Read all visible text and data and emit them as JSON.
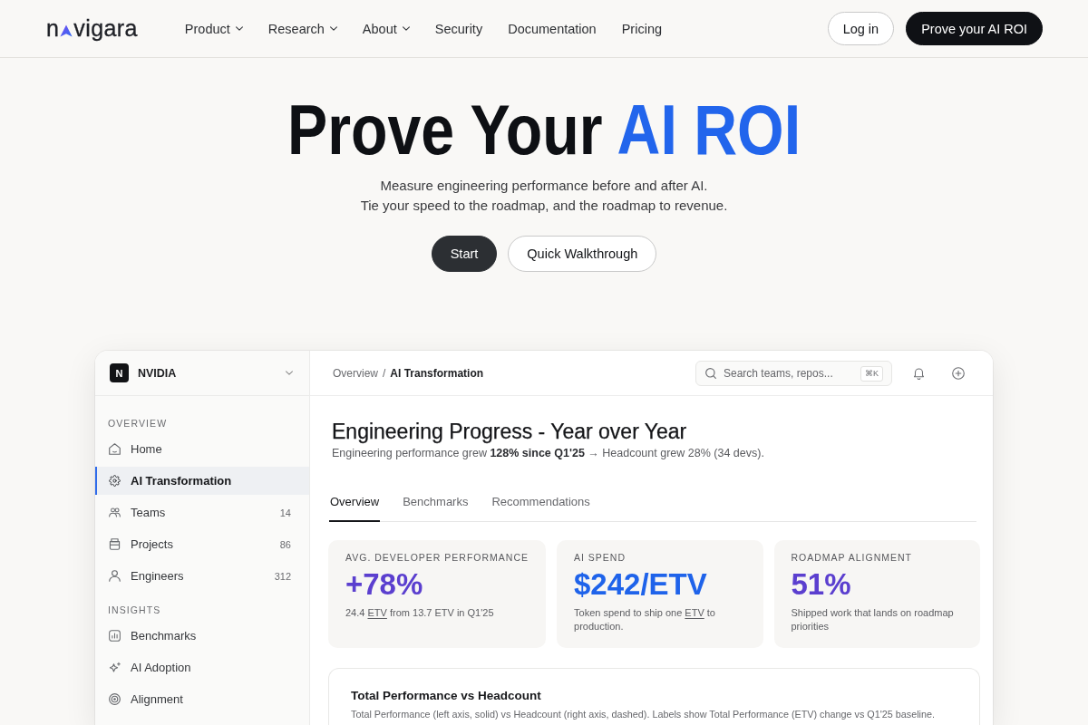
{
  "nav": {
    "logo": {
      "text_start": "n",
      "text_end": "vigara"
    },
    "links": [
      {
        "label": "Product",
        "has_menu": true
      },
      {
        "label": "Research",
        "has_menu": true
      },
      {
        "label": "About",
        "has_menu": true
      },
      {
        "label": "Security",
        "has_menu": false
      },
      {
        "label": "Documentation",
        "has_menu": false
      },
      {
        "label": "Pricing",
        "has_menu": false
      }
    ],
    "actions": [
      {
        "label": "Log in",
        "kind": "outline"
      },
      {
        "label": "Prove your AI ROI",
        "kind": "primary"
      }
    ]
  },
  "hero": {
    "title": [
      {
        "text": "Prove Your",
        "kind": "plain"
      },
      {
        "text": "AI ROI",
        "kind": "accent"
      }
    ],
    "subtitle_lines": [
      "Measure engineering performance before and after AI.",
      "Tie your speed to the roadmap, and the roadmap to revenue."
    ],
    "buttons": [
      {
        "label": "Start",
        "kind": "primary"
      },
      {
        "label": "Quick Walkthrough",
        "kind": "outline"
      }
    ]
  },
  "dashboard": {
    "workspace": {
      "initial": "N",
      "name": "NVIDIA"
    },
    "sidebar": {
      "sections": [
        {
          "title": "OVERVIEW",
          "items": [
            {
              "label": "Home",
              "selected": false
            },
            {
              "label": "AI Transformation",
              "selected": true
            },
            {
              "label": "Teams",
              "count": "14",
              "selected": false
            },
            {
              "label": "Projects",
              "count": "86",
              "selected": false
            },
            {
              "label": "Engineers",
              "count": "312",
              "selected": false
            }
          ]
        },
        {
          "title": "INSIGHTS",
          "items": [
            {
              "label": "Benchmarks",
              "selected": false
            },
            {
              "label": "AI Adoption",
              "selected": false
            },
            {
              "label": "Alignment",
              "selected": false
            }
          ]
        }
      ]
    },
    "breadcrumb": {
      "parent": "Overview",
      "separator": "/",
      "current": "AI Transformation"
    },
    "search": {
      "placeholder": "Search teams, repos...",
      "shortcut": "⌘K"
    },
    "page": {
      "title": "Engineering Progress - Year over Year",
      "subtitle": "Engineering performance grew **128% since Q1'25** → Headcount grew 28% (34 devs)."
    },
    "tabs": [
      {
        "label": "Overview",
        "selected": true
      },
      {
        "label": "Benchmarks",
        "selected": false
      },
      {
        "label": "Recommendations",
        "selected": false
      }
    ],
    "metrics": [
      {
        "label": "AVG. DEVELOPER PERFORMANCE",
        "value": "+78%",
        "color": "#5b3fcf",
        "description": [
          {
            "text": "24.4",
            "kind": "plain"
          },
          {
            "text": "ETV",
            "kind": "term"
          },
          {
            "text": "from 13.7 ETV in Q1'25",
            "kind": "plain"
          }
        ]
      },
      {
        "label": "AI SPEND",
        "value": "$242/ETV",
        "color": "#1f63ea",
        "description": [
          {
            "text": "Token spend to ship one",
            "kind": "plain"
          },
          {
            "text": "ETV",
            "kind": "term"
          },
          {
            "text": "to production.",
            "kind": "plain"
          }
        ]
      },
      {
        "label": "ROADMAP ALIGNMENT",
        "value": "51%",
        "color": "#5b3fcf",
        "description": [
          {
            "text": "Shipped work that lands on roadmap priorities",
            "kind": "plain"
          }
        ]
      }
    ],
    "chart_card": {
      "title": "Total Performance vs Headcount",
      "description": "Total Performance (left axis, solid) vs Headcount (right axis, dashed). Labels show Total Performance (ETV) change vs Q1'25 baseline."
    }
  }
}
